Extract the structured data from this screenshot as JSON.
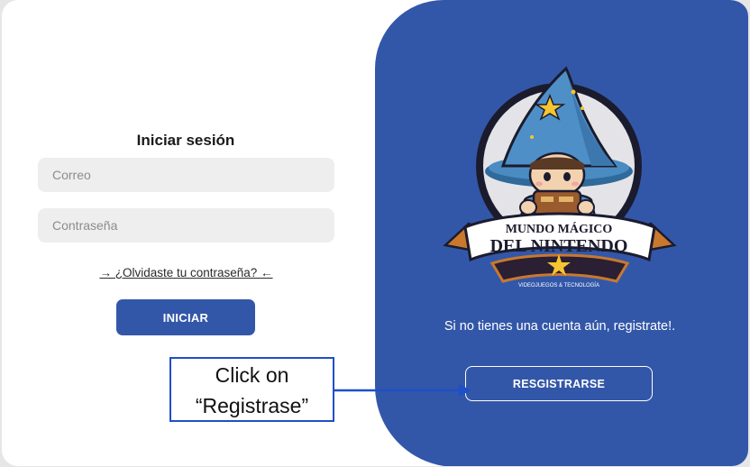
{
  "login": {
    "title": "Iniciar sesión",
    "email_placeholder": "Correo",
    "password_placeholder": "Contraseña",
    "forgot_link": "→ ¿Olvidaste tu contraseña? ←",
    "submit_label": "INICIAR"
  },
  "register_panel": {
    "logo": {
      "line1": "MUNDO MÁGICO",
      "line2": "DEL NINTENDO",
      "tagline": "VIDEOJUEGOS & TECNOLOGÍA",
      "icon": "wizard-mascot"
    },
    "message": "Si no tienes una cuenta aún, registrate!.",
    "register_label": "RESGISTRARSE"
  },
  "annotation": {
    "line1": "Click on",
    "line2": "“Registrase”"
  },
  "colors": {
    "brand_blue": "#3357a8",
    "annotation_blue": "#1f4fc9"
  }
}
